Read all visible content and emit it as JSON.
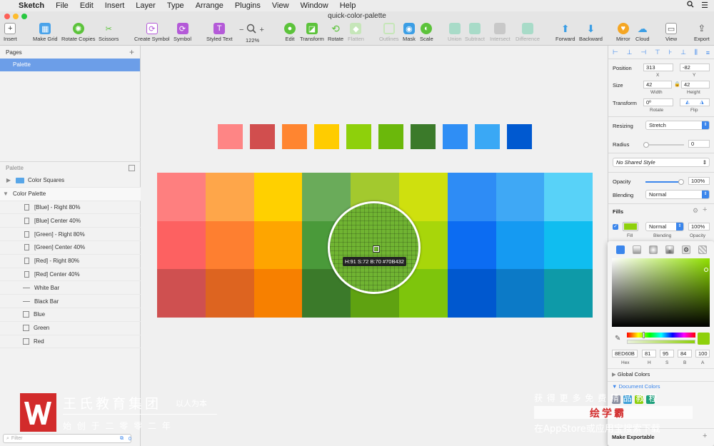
{
  "menubar": {
    "apple": "",
    "app": "Sketch",
    "items": [
      "File",
      "Edit",
      "Insert",
      "Layer",
      "Type",
      "Arrange",
      "Plugins",
      "View",
      "Window",
      "Help"
    ]
  },
  "window": {
    "title": "quick-color-palette"
  },
  "toolbar": {
    "insert": "Insert",
    "make_grid": "Make Grid",
    "rotate_copies": "Rotate Copies",
    "scissors": "Scissors",
    "create_symbol": "Create Symbol",
    "symbol": "Symbol",
    "styled_text": "Styled Text",
    "zoom_minus": "−",
    "zoom_plus": "+",
    "zoom": "122%",
    "edit": "Edit",
    "transform": "Transform",
    "rotate": "Rotate",
    "flatten": "Flatten",
    "outlines": "Outlines",
    "mask": "Mask",
    "scale": "Scale",
    "union": "Union",
    "subtract": "Subtract",
    "intersect": "Intersect",
    "difference": "Difference",
    "forward": "Forward",
    "backward": "Backward",
    "mirror": "Mirror",
    "cloud": "Cloud",
    "view": "View",
    "export": "Export"
  },
  "sidebar": {
    "pages_label": "Pages",
    "add": "+",
    "page": "Palette",
    "layers_label": "Palette",
    "layers": [
      {
        "name": "Color Squares",
        "type": "folder"
      },
      {
        "name": "Color Palette",
        "type": "folder-open"
      },
      {
        "name": "[Blue] - Right 80%",
        "type": "rect"
      },
      {
        "name": "[Blue] Center 40%",
        "type": "rect"
      },
      {
        "name": "[Green] - Right 80%",
        "type": "rect"
      },
      {
        "name": "[Green] Center 40%",
        "type": "rect"
      },
      {
        "name": "[Red] - Right 80%",
        "type": "rect"
      },
      {
        "name": "[Red] Center 40%",
        "type": "rect"
      },
      {
        "name": "White Bar",
        "type": "line"
      },
      {
        "name": "Black Bar",
        "type": "line"
      },
      {
        "name": "Blue",
        "type": "square"
      },
      {
        "name": "Green",
        "type": "square"
      },
      {
        "name": "Red",
        "type": "square"
      }
    ],
    "filter_placeholder": "Filter",
    "filter_count": "0"
  },
  "canvas": {
    "swatches": [
      "#fe8585",
      "#d14e4e",
      "#ff8530",
      "#ffcc00",
      "#8ed00b",
      "#6bb80b",
      "#3b7a2a",
      "#2f8ef5",
      "#3aa8f5",
      "#0059d0"
    ],
    "grid": [
      [
        "#fe7f7f",
        "#fea64a",
        "#ffd000",
        "#6aab5a",
        "#a3c92e",
        "#cfe00e",
        "#2e8cf5",
        "#3fa8f5",
        "#58d2f8"
      ],
      [
        "#fd6161",
        "#fe7f30",
        "#fea500",
        "#4a9a3a",
        "#7fbf1a",
        "#a8d60a",
        "#0c6cf2",
        "#159af2",
        "#10bdf0"
      ],
      [
        "#cf5050",
        "#dd6420",
        "#f78000",
        "#3b7a2a",
        "#5fa211",
        "#7ec50c",
        "#0058cf",
        "#0c7ac7",
        "#0e9aa8"
      ]
    ],
    "loupe_label": "H:91 S:72 B:70 #70B432"
  },
  "inspector": {
    "position_label": "Position",
    "x": "313",
    "y": "-82",
    "x_label": "X",
    "y_label": "Y",
    "size_label": "Size",
    "width": "42",
    "height": "42",
    "width_label": "Width",
    "height_label": "Height",
    "transform_label": "Transform",
    "rotate": "0º",
    "rotate_label": "Rotate",
    "flip_label": "Flip",
    "resizing_label": "Resizing",
    "resizing": "Stretch",
    "radius_label": "Radius",
    "radius": "0",
    "shared_style": "No Shared Style",
    "opacity_label": "Opacity",
    "opacity": "100%",
    "blending_label": "Blending",
    "blending": "Normal",
    "fills_label": "Fills",
    "fill_blend": "Normal",
    "fill_opacity": "100%",
    "fill_sub": "Fill",
    "blend_sub": "Blending",
    "opacity_sub": "Opacity",
    "fill_color": "#8ed00b"
  },
  "picker": {
    "hex": "8ED60B",
    "h": "81",
    "s": "95",
    "b": "84",
    "a": "100",
    "hex_label": "Hex",
    "h_label": "H",
    "s_label": "S",
    "b_label": "B",
    "a_label": "A",
    "global_colors": "Global Colors",
    "document_colors": "Document Colors",
    "doc_swatches": [
      "#8a8fa0",
      "#3d9fd8",
      "#8ed00b",
      "#1b9f7a"
    ],
    "make_exportable": "Make Exportable"
  },
  "watermark": {
    "left_title": "王氏教育集团",
    "left_motto": "以人为本",
    "left_sub": "始 创 于 二 零 零 二 年",
    "right_top": "获 得 更 多 免 费 精 品 教 程",
    "right_brand": "绘学霸",
    "right_bottom": "在AppStore或应用宝搜索下载",
    "colors": {
      "red": "#d22b2b",
      "white": "#ffffff"
    }
  }
}
